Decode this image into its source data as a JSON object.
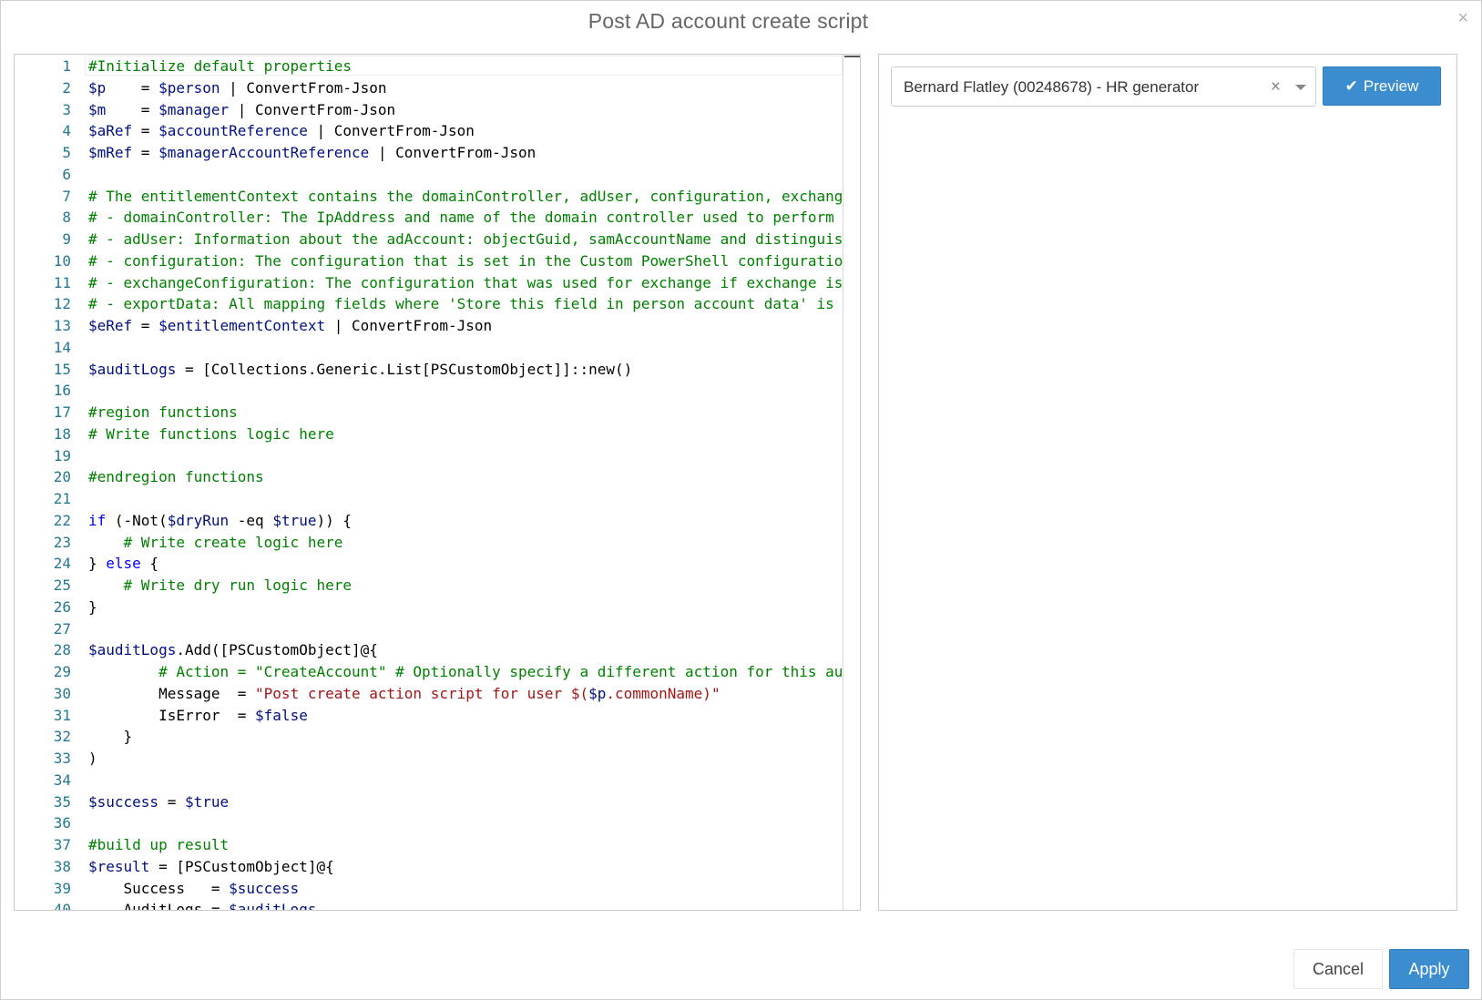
{
  "dialog": {
    "title": "Post AD account create script",
    "close_glyph": "×",
    "close_icon": "close-icon"
  },
  "editor": {
    "lines": [
      {
        "n": "1",
        "segs": [
          [
            "c",
            "#Initialize default properties"
          ]
        ]
      },
      {
        "n": "2",
        "segs": [
          [
            "v",
            "$p"
          ],
          [
            "t",
            "    = "
          ],
          [
            "v",
            "$person"
          ],
          [
            "t",
            " | ConvertFrom-Json"
          ]
        ]
      },
      {
        "n": "3",
        "segs": [
          [
            "v",
            "$m"
          ],
          [
            "t",
            "    = "
          ],
          [
            "v",
            "$manager"
          ],
          [
            "t",
            " | ConvertFrom-Json"
          ]
        ]
      },
      {
        "n": "4",
        "segs": [
          [
            "v",
            "$aRef"
          ],
          [
            "t",
            " = "
          ],
          [
            "v",
            "$accountReference"
          ],
          [
            "t",
            " | ConvertFrom-Json"
          ]
        ]
      },
      {
        "n": "5",
        "segs": [
          [
            "v",
            "$mRef"
          ],
          [
            "t",
            " = "
          ],
          [
            "v",
            "$managerAccountReference"
          ],
          [
            "t",
            " | ConvertFrom-Json"
          ]
        ]
      },
      {
        "n": "6",
        "segs": []
      },
      {
        "n": "7",
        "segs": [
          [
            "c",
            "# The entitlementContext contains the domainController, adUser, configuration, exchangeC"
          ]
        ]
      },
      {
        "n": "8",
        "segs": [
          [
            "c",
            "# - domainController: The IpAddress and name of the domain controller used to perform th"
          ]
        ]
      },
      {
        "n": "9",
        "segs": [
          [
            "c",
            "# - adUser: Information about the adAccount: objectGuid, samAccountName and distinguishe"
          ]
        ]
      },
      {
        "n": "10",
        "segs": [
          [
            "c",
            "# - configuration: The configuration that is set in the Custom PowerShell configuration "
          ]
        ]
      },
      {
        "n": "11",
        "segs": [
          [
            "c",
            "# - exchangeConfiguration: The configuration that was used for exchange if exchange is t"
          ]
        ]
      },
      {
        "n": "12",
        "segs": [
          [
            "c",
            "# - exportData: All mapping fields where 'Store this field in person account data' is tu"
          ]
        ]
      },
      {
        "n": "13",
        "segs": [
          [
            "v",
            "$eRef"
          ],
          [
            "t",
            " = "
          ],
          [
            "v",
            "$entitlementContext"
          ],
          [
            "t",
            " | ConvertFrom-Json"
          ]
        ]
      },
      {
        "n": "14",
        "segs": []
      },
      {
        "n": "15",
        "segs": [
          [
            "v",
            "$auditLogs"
          ],
          [
            "t",
            " = [Collections.Generic.List[PSCustomObject]]::new()"
          ]
        ]
      },
      {
        "n": "16",
        "segs": []
      },
      {
        "n": "17",
        "segs": [
          [
            "c",
            "#region functions"
          ]
        ]
      },
      {
        "n": "18",
        "segs": [
          [
            "c",
            "# Write functions logic here"
          ]
        ]
      },
      {
        "n": "19",
        "segs": []
      },
      {
        "n": "20",
        "segs": [
          [
            "c",
            "#endregion functions"
          ]
        ]
      },
      {
        "n": "21",
        "segs": []
      },
      {
        "n": "22",
        "segs": [
          [
            "k",
            "if"
          ],
          [
            "t",
            " (-Not("
          ],
          [
            "v",
            "$dryRun"
          ],
          [
            "t",
            " -eq "
          ],
          [
            "v",
            "$true"
          ],
          [
            "t",
            ")) {"
          ]
        ]
      },
      {
        "n": "23",
        "segs": [
          [
            "t",
            "    "
          ],
          [
            "c",
            "# Write create logic here"
          ]
        ]
      },
      {
        "n": "24",
        "segs": [
          [
            "t",
            "} "
          ],
          [
            "k",
            "else"
          ],
          [
            "t",
            " {"
          ]
        ]
      },
      {
        "n": "25",
        "segs": [
          [
            "t",
            "    "
          ],
          [
            "c",
            "# Write dry run logic here"
          ]
        ]
      },
      {
        "n": "26",
        "segs": [
          [
            "t",
            "}"
          ]
        ]
      },
      {
        "n": "27",
        "segs": []
      },
      {
        "n": "28",
        "segs": [
          [
            "v",
            "$auditLogs"
          ],
          [
            "t",
            ".Add([PSCustomObject]@{"
          ]
        ]
      },
      {
        "n": "29",
        "segs": [
          [
            "t",
            "        "
          ],
          [
            "c",
            "# Action = \"CreateAccount\" # Optionally specify a different action for this audi"
          ]
        ]
      },
      {
        "n": "30",
        "segs": [
          [
            "t",
            "        Message  = "
          ],
          [
            "s",
            "\"Post create action script for user $("
          ],
          [
            "v",
            "$p"
          ],
          [
            "s",
            ".commonName)\""
          ]
        ]
      },
      {
        "n": "31",
        "segs": [
          [
            "t",
            "        IsError  = "
          ],
          [
            "v",
            "$false"
          ]
        ]
      },
      {
        "n": "32",
        "segs": [
          [
            "t",
            "    }"
          ]
        ]
      },
      {
        "n": "33",
        "segs": [
          [
            "t",
            ")"
          ]
        ]
      },
      {
        "n": "34",
        "segs": []
      },
      {
        "n": "35",
        "segs": [
          [
            "v",
            "$success"
          ],
          [
            "t",
            " = "
          ],
          [
            "v",
            "$true"
          ]
        ]
      },
      {
        "n": "36",
        "segs": []
      },
      {
        "n": "37",
        "segs": [
          [
            "c",
            "#build up result"
          ]
        ]
      },
      {
        "n": "38",
        "segs": [
          [
            "v",
            "$result"
          ],
          [
            "t",
            " = [PSCustomObject]@{"
          ]
        ]
      },
      {
        "n": "39",
        "segs": [
          [
            "t",
            "    Success   = "
          ],
          [
            "v",
            "$success"
          ]
        ]
      },
      {
        "n": "40",
        "segs": [
          [
            "t",
            "    AuditLogs = "
          ],
          [
            "v",
            "$auditLogs"
          ]
        ]
      }
    ]
  },
  "preview_panel": {
    "person_select": {
      "value": "Bernard Flatley (00248678) - HR generator",
      "clear_glyph": "×"
    },
    "preview_button": {
      "icon_glyph": "✔",
      "icon": "check-icon",
      "label": "Preview"
    }
  },
  "footer": {
    "cancel_label": "Cancel",
    "apply_label": "Apply"
  },
  "colors": {
    "accent": "#3c8dcf",
    "comment": "#008000",
    "variable": "#001080",
    "keyword": "#0000ff",
    "string": "#a31515",
    "line_number": "#237893"
  }
}
